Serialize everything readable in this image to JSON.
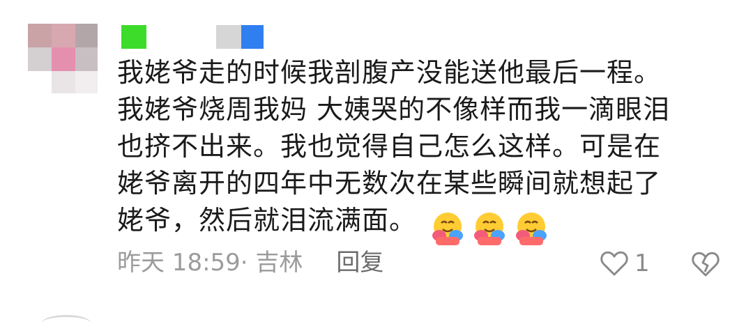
{
  "comment": {
    "lines": [
      "我姥爷走的时候我剖腹产没能送他最后一程。",
      "我姥爷烧周我妈 大姨哭的不像样而我一滴眼泪",
      "也挤不出来。我也觉得自己怎么这样。可是在",
      "姥爷离开的四年中无数次在某些瞬间就想起了",
      "姥爷，然后就泪流满面。"
    ],
    "emoji": [
      "hugging-face-emoji",
      "hugging-face-emoji",
      "hugging-face-emoji"
    ]
  },
  "meta": {
    "time_location": "昨天 18:59· 吉林",
    "reply_label": "回复"
  },
  "actions": {
    "like_count": "1",
    "like_icon": "heart-outline-icon",
    "dislike_icon": "broken-heart-icon"
  },
  "colors": {
    "text": "#1a1a1a",
    "meta": "#9b9b9b",
    "reply": "#6b6b6b",
    "icon": "#8a8a8a"
  }
}
